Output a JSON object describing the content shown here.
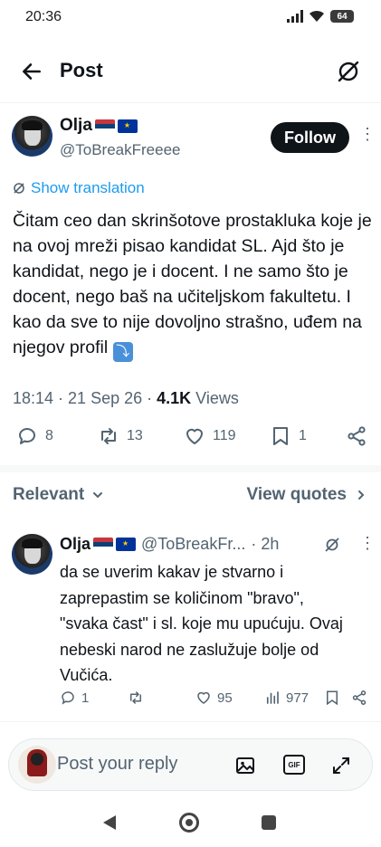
{
  "status_bar": {
    "time": "20:36",
    "battery": "64"
  },
  "header": {
    "title": "Post"
  },
  "post": {
    "author_name": "Olja",
    "handle": "@ToBreakFreeee",
    "follow_label": "Follow",
    "show_translation": "Show translation",
    "text": "Čitam ceo dan skrinšotove prostakluka koje je na ovoj mreži pisao kandidat SL. Ajd što je kandidat, nego je i docent. I ne samo što je docent, nego baš na učiteljskom fakultetu. I kao da sve to nije dovoljno strašno, uđem na njegov profil",
    "emoji": "⤵",
    "time": "18:14",
    "date": "21 Sep 26",
    "views_count": "4.1K",
    "views_label": "Views",
    "replies": "8",
    "reposts": "13",
    "likes": "119",
    "bookmarks": "1"
  },
  "sort": {
    "relevant_label": "Relevant",
    "view_quotes_label": "View quotes"
  },
  "reply": {
    "author_name": "Olja",
    "handle": "@ToBreakFr...",
    "time": "· 2h",
    "text": "da se uverim kakav je stvarno i zaprepastim se količinom \"bravo\", \"svaka čast\" i sl. koje mu upućuju. Ovaj nebeski narod ne zaslužuje bolje od Vučića.",
    "replies": "1",
    "likes": "95",
    "views": "977"
  },
  "composer": {
    "placeholder": "Post your reply",
    "gif_label": "GIF"
  }
}
